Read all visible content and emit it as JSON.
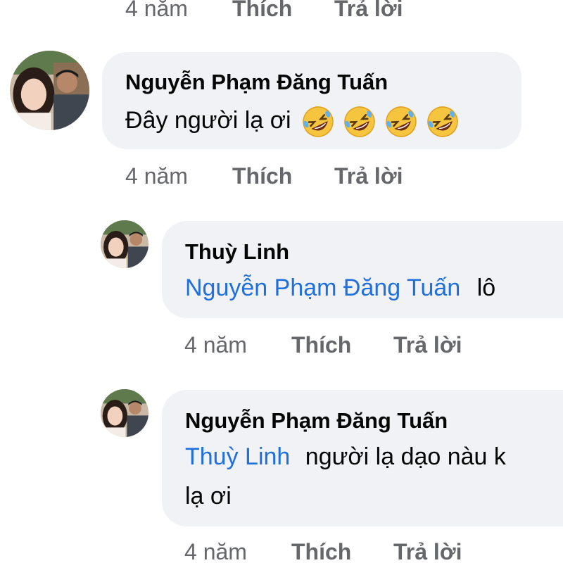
{
  "colors": {
    "bubble": "#f0f2f5",
    "mention": "#216fdb",
    "meta": "#65676b",
    "text": "#050505"
  },
  "top_actions": {
    "time": "4 năm",
    "like": "Thích",
    "reply": "Trả lời"
  },
  "comments": [
    {
      "author": "Nguyễn Phạm Đăng Tuấn",
      "text": "Đây người lạ ơi",
      "emojis": [
        "rolling-on-floor-laughing-icon",
        "rolling-on-floor-laughing-icon",
        "rolling-on-floor-laughing-icon",
        "rolling-on-floor-laughing-icon"
      ],
      "actions": {
        "time": "4 năm",
        "like": "Thích",
        "reply": "Trả lời"
      }
    },
    {
      "author": "Thuỳ Linh",
      "mention": "Nguyễn Phạm Đăng Tuấn",
      "text": "lô",
      "actions": {
        "time": "4 năm",
        "like": "Thích",
        "reply": "Trả lời"
      }
    },
    {
      "author": "Nguyễn Phạm Đăng Tuấn",
      "mention": "Thuỳ Linh",
      "text": "người lạ dạo nàu k",
      "text_line2": "lạ ơi",
      "actions": {
        "time": "4 năm",
        "like": "Thích",
        "reply": "Trả lời"
      }
    }
  ]
}
